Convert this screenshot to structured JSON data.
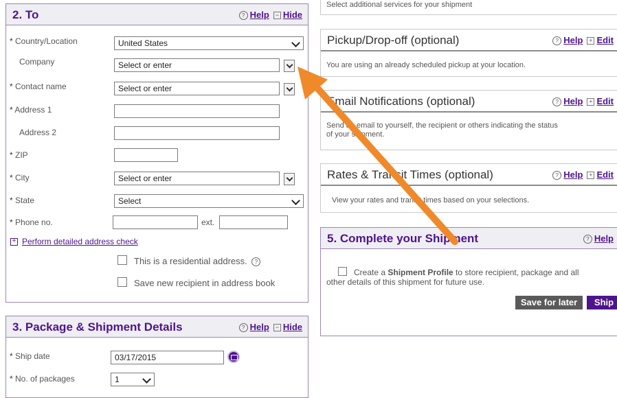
{
  "to_section": {
    "title": "2. To",
    "help_label": "Help",
    "hide_label": "Hide",
    "country_label": "Country/Location",
    "country_value": "United States",
    "company_label": "Company",
    "company_value": "Select or enter",
    "contact_label": "Contact name",
    "contact_value": "Select or enter",
    "address1_label": "Address 1",
    "address2_label": "Address 2",
    "zip_label": "ZIP",
    "city_label": "City",
    "city_value": "Select or enter",
    "state_label": "State",
    "state_value": "Select",
    "phone_label": "Phone no.",
    "ext_label": "ext.",
    "address_check_link": "Perform detailed address check",
    "residential_label": "This is a residential address.",
    "save_recipient_label": "Save new recipient in address book"
  },
  "package_section": {
    "title": "3. Package & Shipment Details",
    "help_label": "Help",
    "hide_label": "Hide",
    "ship_date_label": "Ship date",
    "ship_date_value": "03/17/2015",
    "packages_label": "No. of packages",
    "packages_value": "1"
  },
  "services": {
    "description": "Select additional services for your shipment"
  },
  "pickup": {
    "title": "Pickup/Drop-off (optional)",
    "help_label": "Help",
    "edit_label": "Edit",
    "description": "You are using an already scheduled pickup at your location."
  },
  "email": {
    "title": "Email Notifications (optional)",
    "help_label": "Help",
    "edit_label": "Edit",
    "description_line1": "Send an email to yourself, the recipient or others indicating the status",
    "description_line2": "of your shipment."
  },
  "rates": {
    "title": "Rates & Transit Times (optional)",
    "help_label": "Help",
    "edit_label": "Edit",
    "description": "View your rates and transit times based on your selections."
  },
  "complete": {
    "title": "5. Complete your Shipment",
    "help_label": "Help",
    "profile_prefix": "Create a ",
    "profile_bold": "Shipment Profile",
    "profile_suffix": " to store recipient, package and all",
    "profile_line2": "other details of this shipment for future use.",
    "save_later_label": "Save for later",
    "ship_label": "Ship"
  },
  "colors": {
    "brand_purple": "#4d148c",
    "annotation_arrow": "#f0892a"
  }
}
